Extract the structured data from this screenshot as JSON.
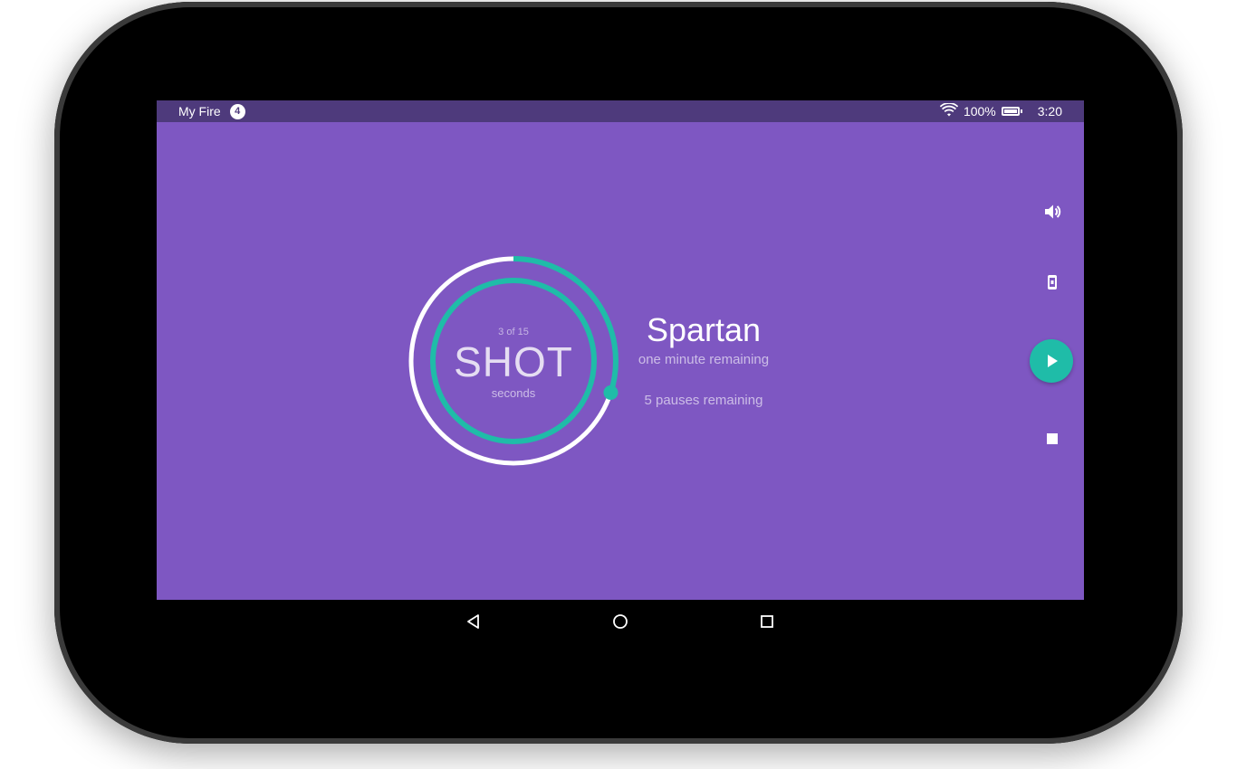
{
  "status_bar": {
    "app_name": "My Fire",
    "notification_count": "4",
    "battery": "100%",
    "time": "3:20"
  },
  "timer": {
    "count": "3 of 15",
    "label": "SHOT",
    "unit": "seconds",
    "outer_progress": 0.3,
    "inner_progress": 1.0
  },
  "workout": {
    "title": "Spartan",
    "remaining": "one minute remaining",
    "pauses": "5 pauses remaining"
  },
  "controls": {
    "volume_icon": "volume-up-icon",
    "screen_icon": "keep-screen-on-icon",
    "play_icon": "play-icon",
    "stop_icon": "stop-icon"
  },
  "nav": {
    "back_icon": "back-icon",
    "home_icon": "home-icon",
    "recents_icon": "recents-icon"
  },
  "colors": {
    "background": "#7e57c2",
    "status_bar": "#4e3a7c",
    "accent": "#1fbca8",
    "text": "#ffffff"
  }
}
